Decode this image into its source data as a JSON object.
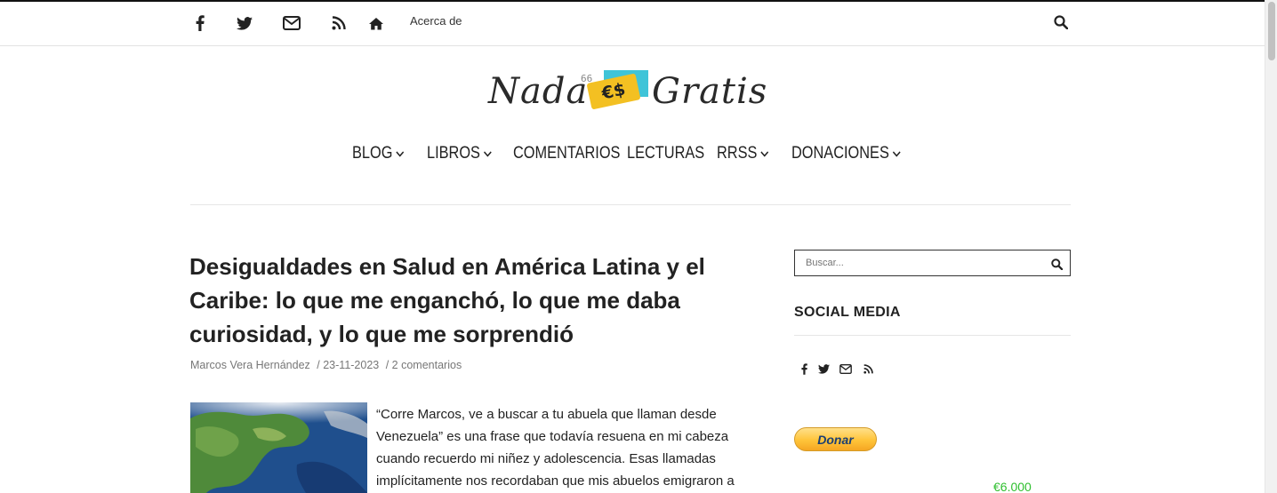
{
  "topbar": {
    "icons": [
      "facebook-icon",
      "twitter-icon",
      "envelope-icon",
      "rss-icon",
      "home-icon"
    ],
    "about_label": "Acerca de",
    "search_icon": "search-icon"
  },
  "logo": {
    "word_left": "Nada",
    "word_right": "Gratis",
    "badge_text": "€$",
    "scribble_text": "66"
  },
  "nav": {
    "items": [
      {
        "label": "BLOG",
        "has_dropdown": true
      },
      {
        "label": "LIBROS",
        "has_dropdown": true
      },
      {
        "label": "COMENTARIOS",
        "has_dropdown": false
      },
      {
        "label": "LECTURAS",
        "has_dropdown": false
      },
      {
        "label": "RRSS",
        "has_dropdown": true
      },
      {
        "label": "DONACIONES",
        "has_dropdown": true
      }
    ]
  },
  "post": {
    "title": "Desigualdades en Salud en América Latina y el Caribe: lo que me enganchó, lo que me daba curiosidad, y lo que me sorprendió",
    "author": "Marcos Vera Hernández",
    "date": "/ 23-11-2023",
    "comments": "/ 2 comentarios",
    "excerpt": "“Corre Marcos, ve a buscar a tu abuela que llaman desde Venezuela” es una frase que todavía resuena en mi cabeza cuando recuerdo mi niñez y adolescencia. Esas llamadas implícitamente nos recordaban que mis abuelos emigraron a"
  },
  "sidebar": {
    "search_placeholder": "Buscar...",
    "social_title": "SOCIAL MEDIA",
    "social_icons": [
      "facebook-icon",
      "twitter-icon",
      "envelope-icon",
      "rss-icon"
    ],
    "donate_label": "Donar",
    "amount": "€6.000"
  },
  "colors": {
    "accent_green": "#2fbf2f",
    "logo_yellow": "#f3c022",
    "logo_cyan": "#3fc4d8",
    "paypal_gold": "#ffc439"
  }
}
